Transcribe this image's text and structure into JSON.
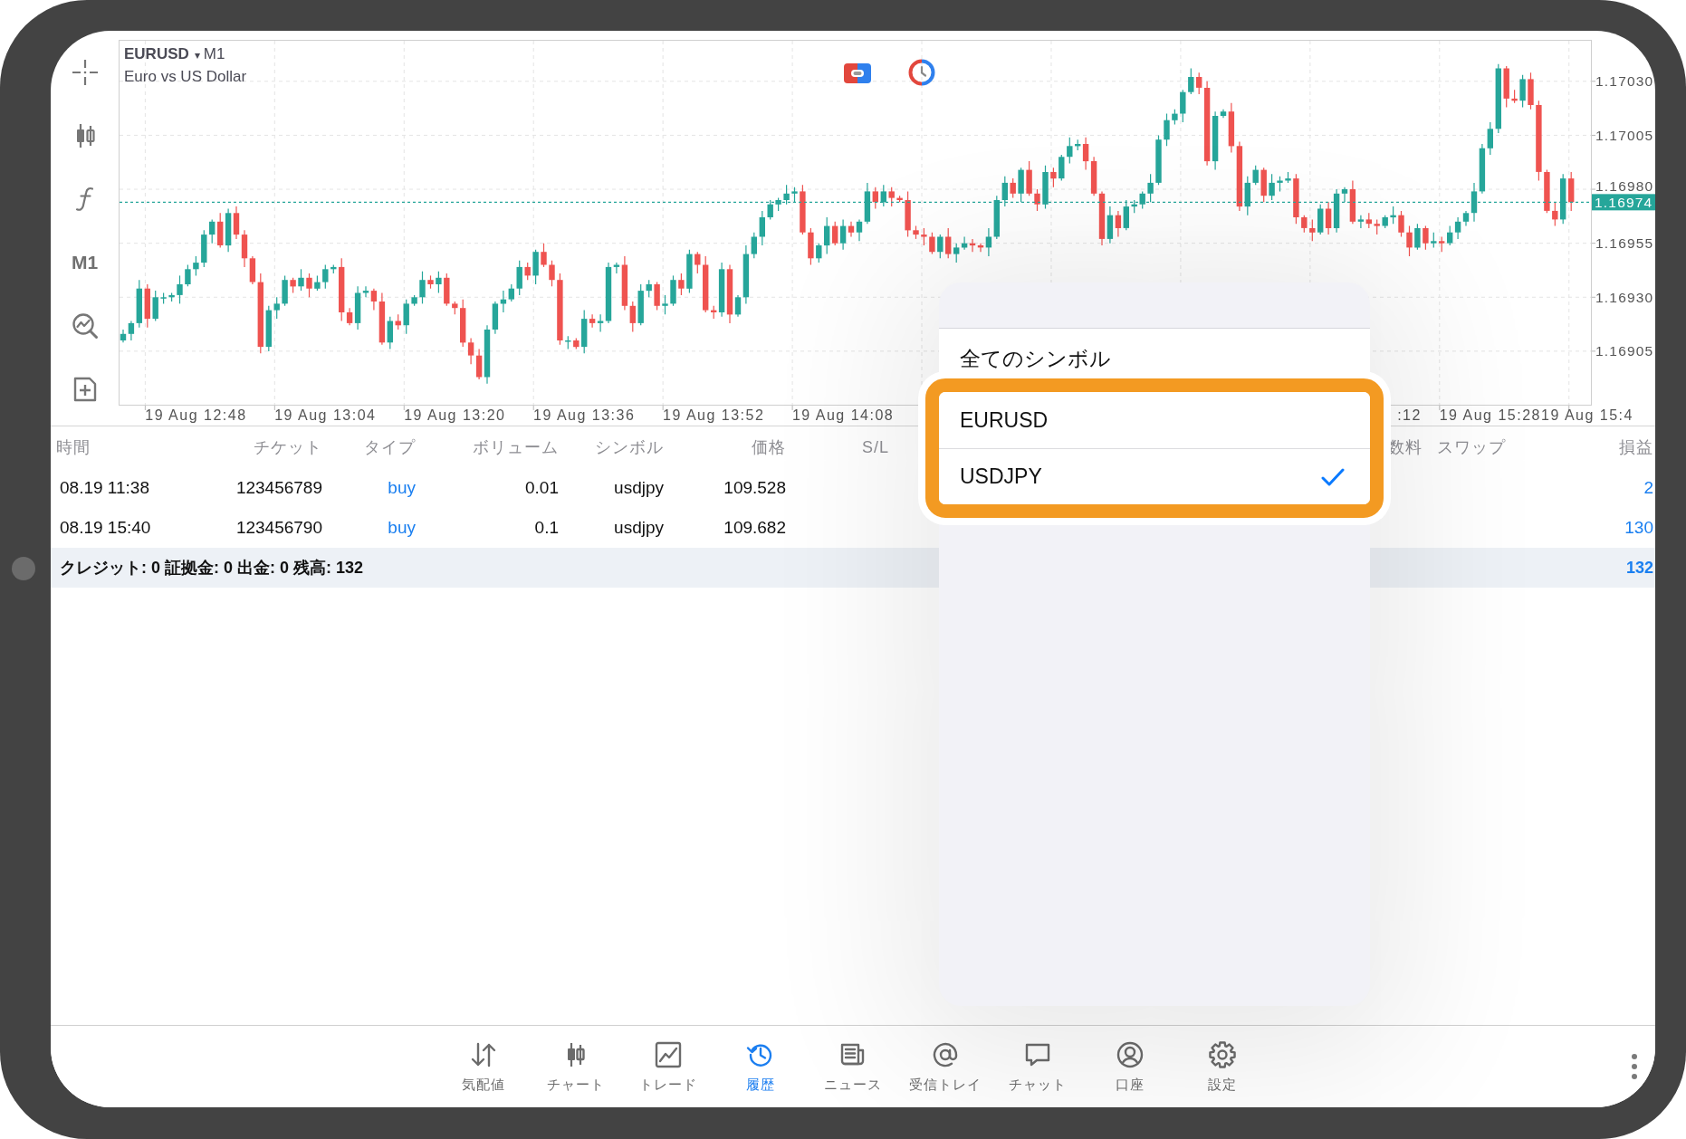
{
  "chart": {
    "symbol": "EURUSD",
    "symbol_caret": "▾",
    "timeframe": "M1",
    "description": "Euro vs US Dollar",
    "toolbar_timeframe": "M1",
    "chart_data": {
      "type": "candlestick",
      "categories": [
        null,
        null,
        null,
        null,
        null,
        null,
        null,
        null,
        null,
        "19 Aug 12:48",
        null,
        null,
        null,
        null,
        null,
        null,
        null,
        null,
        null,
        null,
        null,
        null,
        null,
        null,
        null,
        "19 Aug 13:04",
        null,
        null,
        null,
        null,
        null,
        null,
        null,
        null,
        null,
        null,
        null,
        null,
        null,
        null,
        null,
        "19 Aug 13:20",
        null,
        null,
        null,
        null,
        null,
        null,
        null,
        null,
        null,
        null,
        null,
        null,
        null,
        null,
        null,
        "19 Aug 13:36",
        null,
        null,
        null,
        null,
        null,
        null,
        null,
        null,
        null,
        null,
        null,
        null,
        null,
        null,
        null,
        "19 Aug 13:52",
        null,
        null,
        null,
        null,
        null,
        null,
        null,
        null,
        null,
        null,
        null,
        null,
        null,
        null,
        null,
        "19 Aug 14:08",
        null,
        null,
        null,
        null,
        null,
        null,
        null,
        null,
        null,
        null,
        null,
        null,
        null,
        null,
        null,
        null,
        null,
        null,
        null,
        null,
        null,
        null,
        null,
        null,
        null,
        null,
        null,
        null,
        null,
        null,
        null,
        null,
        null,
        null,
        null,
        null,
        null,
        null,
        null,
        null,
        null,
        null,
        null,
        null,
        null,
        null,
        null,
        null,
        null,
        null,
        null,
        null,
        null,
        null,
        null,
        null,
        null,
        null,
        null,
        null,
        null,
        null,
        null,
        null,
        null,
        null,
        null,
        null,
        null,
        ":12",
        null,
        null,
        null,
        null,
        null,
        null,
        null,
        null,
        null,
        "19 Aug 15:28",
        null,
        null,
        null,
        null,
        null,
        null,
        null,
        null,
        null,
        null,
        null,
        "19 Aug 15:4"
      ],
      "ohlc": [
        [
          1.1691,
          1.16915,
          1.16909,
          1.16913
        ],
        [
          1.16913,
          1.16919,
          1.1691,
          1.16918
        ],
        [
          1.16918,
          1.16938,
          1.16916,
          1.16934
        ],
        [
          1.16934,
          1.16936,
          1.16916,
          1.1692
        ],
        [
          1.1692,
          1.16933,
          1.16919,
          1.1693
        ],
        [
          1.1693,
          1.16932,
          1.16927,
          1.1693
        ],
        [
          1.1693,
          1.16932,
          1.16928,
          1.16931
        ],
        [
          1.16931,
          1.1694,
          1.16927,
          1.16936
        ],
        [
          1.16936,
          1.16945,
          1.16935,
          1.16943
        ],
        [
          1.16943,
          1.16949,
          1.1694,
          1.16946
        ],
        [
          1.16946,
          1.16961,
          1.16944,
          1.16959
        ],
        [
          1.16959,
          1.16966,
          1.16955,
          1.16965
        ],
        [
          1.16965,
          1.16969,
          1.16953,
          1.16954
        ],
        [
          1.16954,
          1.16971,
          1.16951,
          1.16969
        ],
        [
          1.16969,
          1.16972,
          1.16957,
          1.16959
        ],
        [
          1.16959,
          1.16961,
          1.16944,
          1.16948
        ],
        [
          1.16948,
          1.16949,
          1.16936,
          1.16937
        ],
        [
          1.16937,
          1.16941,
          1.16904,
          1.16907
        ],
        [
          1.16907,
          1.16926,
          1.16905,
          1.16924
        ],
        [
          1.16924,
          1.1693,
          1.1692,
          1.16927
        ],
        [
          1.16927,
          1.1694,
          1.16926,
          1.16938
        ],
        [
          1.16938,
          1.16939,
          1.16932,
          1.16935
        ],
        [
          1.16935,
          1.16943,
          1.16933,
          1.16939
        ],
        [
          1.16939,
          1.16941,
          1.1693,
          1.16934
        ],
        [
          1.16934,
          1.1694,
          1.16933,
          1.16937
        ],
        [
          1.16937,
          1.16945,
          1.16934,
          1.16943
        ],
        [
          1.16943,
          1.16945,
          1.16941,
          1.16944
        ],
        [
          1.16944,
          1.16948,
          1.16919,
          1.16923
        ],
        [
          1.16923,
          1.16925,
          1.16917,
          1.16918
        ],
        [
          1.16918,
          1.16935,
          1.16915,
          1.16932
        ],
        [
          1.16932,
          1.16935,
          1.1693,
          1.16933
        ],
        [
          1.16933,
          1.16934,
          1.16924,
          1.16928
        ],
        [
          1.16928,
          1.16932,
          1.16908,
          1.16909
        ],
        [
          1.16909,
          1.16921,
          1.16906,
          1.16919
        ],
        [
          1.16919,
          1.16922,
          1.16915,
          1.16917
        ],
        [
          1.16917,
          1.16929,
          1.16913,
          1.16927
        ],
        [
          1.16927,
          1.16931,
          1.16926,
          1.1693
        ],
        [
          1.1693,
          1.16942,
          1.16927,
          1.16938
        ],
        [
          1.16938,
          1.1694,
          1.16934,
          1.16936
        ],
        [
          1.16936,
          1.16942,
          1.16932,
          1.16939
        ],
        [
          1.16939,
          1.16941,
          1.16926,
          1.16927
        ],
        [
          1.16927,
          1.16928,
          1.16922,
          1.16925
        ],
        [
          1.16925,
          1.16929,
          1.16907,
          1.16909
        ],
        [
          1.16909,
          1.16911,
          1.16899,
          1.16903
        ],
        [
          1.16903,
          1.16906,
          1.16892,
          1.16893
        ],
        [
          1.16893,
          1.16917,
          1.1689,
          1.16915
        ],
        [
          1.16915,
          1.16928,
          1.16913,
          1.16927
        ],
        [
          1.16927,
          1.16933,
          1.16923,
          1.16929
        ],
        [
          1.16929,
          1.16936,
          1.16928,
          1.16934
        ],
        [
          1.16934,
          1.16947,
          1.16931,
          1.16944
        ],
        [
          1.16944,
          1.16946,
          1.16938,
          1.1694
        ],
        [
          1.1694,
          1.16952,
          1.16936,
          1.16951
        ],
        [
          1.16951,
          1.16955,
          1.16944,
          1.16945
        ],
        [
          1.16945,
          1.16947,
          1.16935,
          1.16938
        ],
        [
          1.16938,
          1.16941,
          1.16908,
          1.1691
        ],
        [
          1.1691,
          1.16912,
          1.16906,
          1.1691
        ],
        [
          1.1691,
          1.16911,
          1.16906,
          1.16907
        ],
        [
          1.16907,
          1.16924,
          1.16904,
          1.1692
        ],
        [
          1.1692,
          1.16922,
          1.16916,
          1.16918
        ],
        [
          1.16918,
          1.16922,
          1.16914,
          1.16919
        ],
        [
          1.16919,
          1.16946,
          1.16918,
          1.16944
        ],
        [
          1.16944,
          1.16946,
          1.16941,
          1.16945
        ],
        [
          1.16945,
          1.16949,
          1.16924,
          1.16926
        ],
        [
          1.16926,
          1.16928,
          1.16914,
          1.16918
        ],
        [
          1.16918,
          1.16936,
          1.16917,
          1.16933
        ],
        [
          1.16933,
          1.16938,
          1.1693,
          1.16936
        ],
        [
          1.16936,
          1.16937,
          1.16924,
          1.16926
        ],
        [
          1.16926,
          1.16931,
          1.16922,
          1.16927
        ],
        [
          1.16927,
          1.1694,
          1.16926,
          1.16938
        ],
        [
          1.16938,
          1.16941,
          1.16931,
          1.16934
        ],
        [
          1.16934,
          1.16952,
          1.16932,
          1.1695
        ],
        [
          1.1695,
          1.16951,
          1.16941,
          1.16945
        ],
        [
          1.16945,
          1.16949,
          1.16923,
          1.16924
        ],
        [
          1.16924,
          1.16926,
          1.1692,
          1.16923
        ],
        [
          1.16923,
          1.16946,
          1.16921,
          1.16943
        ],
        [
          1.16943,
          1.16945,
          1.16918,
          1.16922
        ],
        [
          1.16922,
          1.16931,
          1.16921,
          1.1693
        ],
        [
          1.1693,
          1.16954,
          1.16927,
          1.1695
        ],
        [
          1.1695,
          1.1696,
          1.16948,
          1.16958
        ],
        [
          1.16958,
          1.1697,
          1.16954,
          1.16967
        ],
        [
          1.16967,
          1.16975,
          1.16966,
          1.16973
        ],
        [
          1.16973,
          1.16976,
          1.1697,
          1.16975
        ],
        [
          1.16975,
          1.16982,
          1.16973,
          1.16978
        ],
        [
          1.16978,
          1.16981,
          1.16974,
          1.16979
        ],
        [
          1.16979,
          1.16982,
          1.16959,
          1.1696
        ],
        [
          1.1696,
          1.16962,
          1.16945,
          1.16948
        ],
        [
          1.16948,
          1.16955,
          1.16946,
          1.16954
        ],
        [
          1.16954,
          1.16967,
          1.1695,
          1.16963
        ],
        [
          1.16963,
          1.16965,
          1.16954,
          1.16955
        ],
        [
          1.16955,
          1.16966,
          1.16952,
          1.16963
        ],
        [
          1.16963,
          1.16965,
          1.16958,
          1.1696
        ],
        [
          1.1696,
          1.16966,
          1.16956,
          1.16965
        ],
        [
          1.16965,
          1.16983,
          1.16964,
          1.16979
        ],
        [
          1.16979,
          1.16981,
          1.16971,
          1.16974
        ],
        [
          1.16974,
          1.16982,
          1.16972,
          1.16979
        ],
        [
          1.16979,
          1.16981,
          1.16972,
          1.16976
        ],
        [
          1.16976,
          1.16977,
          1.16974,
          1.16975
        ],
        [
          1.16975,
          1.16979,
          1.16958,
          1.16961
        ],
        [
          1.16961,
          1.16963,
          1.16957,
          1.16959
        ],
        [
          1.16959,
          1.16962,
          1.16954,
          1.16958
        ],
        [
          1.16958,
          1.1696,
          1.1695,
          1.16951
        ],
        [
          1.16951,
          1.16959,
          1.16948,
          1.16958
        ],
        [
          1.16958,
          1.16962,
          1.16948,
          1.1695
        ],
        [
          1.1695,
          1.16955,
          1.16946,
          1.16953
        ],
        [
          1.16953,
          1.16958,
          1.16952,
          1.16955
        ],
        [
          1.16955,
          1.16957,
          1.16951,
          1.16954
        ],
        [
          1.16954,
          1.16955,
          1.16951,
          1.16953
        ],
        [
          1.16953,
          1.16962,
          1.16949,
          1.16958
        ],
        [
          1.16958,
          1.16977,
          1.16957,
          1.16975
        ],
        [
          1.16975,
          1.16986,
          1.16972,
          1.16983
        ],
        [
          1.16983,
          1.16985,
          1.16976,
          1.16978
        ],
        [
          1.16978,
          1.1699,
          1.16974,
          1.16989
        ],
        [
          1.16989,
          1.16993,
          1.16977,
          1.16978
        ],
        [
          1.16978,
          1.1698,
          1.1697,
          1.16973
        ],
        [
          1.16973,
          1.16991,
          1.16971,
          1.16988
        ],
        [
          1.16988,
          1.1699,
          1.16981,
          1.16985
        ],
        [
          1.16985,
          1.16996,
          1.16984,
          1.16995
        ],
        [
          1.16995,
          1.17004,
          1.16992,
          1.17
        ],
        [
          1.17,
          1.17003,
          1.16998,
          1.17001
        ],
        [
          1.17001,
          1.17004,
          1.16989,
          1.16993
        ],
        [
          1.16993,
          1.16995,
          1.16977,
          1.16978
        ],
        [
          1.16978,
          1.16979,
          1.16954,
          1.16957
        ],
        [
          1.16957,
          1.16972,
          1.16955,
          1.16968
        ],
        [
          1.16968,
          1.1697,
          1.16958,
          1.16962
        ],
        [
          1.16962,
          1.16975,
          1.16961,
          1.16972
        ],
        [
          1.16972,
          1.16975,
          1.16969,
          1.16973
        ],
        [
          1.16973,
          1.16979,
          1.16971,
          1.16978
        ],
        [
          1.16978,
          1.16987,
          1.16974,
          1.16983
        ],
        [
          1.16983,
          1.17005,
          1.16982,
          1.17003
        ],
        [
          1.17003,
          1.17015,
          1.17,
          1.17012
        ],
        [
          1.17012,
          1.17017,
          1.1701,
          1.17015
        ],
        [
          1.17015,
          1.17026,
          1.17011,
          1.17025
        ],
        [
          1.17025,
          1.17036,
          1.17024,
          1.17032
        ],
        [
          1.17032,
          1.17034,
          1.17024,
          1.17027
        ],
        [
          1.17027,
          1.1703,
          1.16991,
          1.16993
        ],
        [
          1.16993,
          1.17016,
          1.16989,
          1.17014
        ],
        [
          1.17014,
          1.17017,
          1.17013,
          1.17016
        ],
        [
          1.17016,
          1.1702,
          1.16997,
          1.17
        ],
        [
          1.17,
          1.17002,
          1.1697,
          1.16972
        ],
        [
          1.16972,
          1.16986,
          1.16968,
          1.16983
        ],
        [
          1.16983,
          1.16991,
          1.16982,
          1.16989
        ],
        [
          1.16989,
          1.1699,
          1.16974,
          1.16977
        ],
        [
          1.16977,
          1.16987,
          1.16975,
          1.16983
        ],
        [
          1.16983,
          1.16986,
          1.16979,
          1.16984
        ],
        [
          1.16984,
          1.16988,
          1.16983,
          1.16985
        ],
        [
          1.16985,
          1.16987,
          1.16964,
          1.16967
        ],
        [
          1.16967,
          1.16968,
          1.1696,
          1.16962
        ],
        [
          1.16962,
          1.16966,
          1.16956,
          1.1696
        ],
        [
          1.1696,
          1.16973,
          1.16959,
          1.16971
        ],
        [
          1.16971,
          1.16974,
          1.16959,
          1.16962
        ],
        [
          1.16962,
          1.1698,
          1.1696,
          1.16978
        ],
        [
          1.16978,
          1.16981,
          1.16974,
          1.1698
        ],
        [
          1.1698,
          1.16984,
          1.16964,
          1.16965
        ],
        [
          1.16965,
          1.16968,
          1.16962,
          1.16966
        ],
        [
          1.16966,
          1.16969,
          1.16962,
          1.16964
        ],
        [
          1.16964,
          1.16966,
          1.16959,
          1.16963
        ],
        [
          1.16963,
          1.16968,
          1.16962,
          1.16967
        ],
        [
          1.16967,
          1.16972,
          1.16964,
          1.16968
        ],
        [
          1.16968,
          1.1697,
          1.16958,
          1.1696
        ],
        [
          1.1696,
          1.16963,
          1.16949,
          1.16953
        ],
        [
          1.16953,
          1.16964,
          1.16952,
          1.16962
        ],
        [
          1.16962,
          1.16963,
          1.16952,
          1.16955
        ],
        [
          1.16955,
          1.1696,
          1.16953,
          1.16956
        ],
        [
          1.16956,
          1.16958,
          1.16951,
          1.16955
        ],
        [
          1.16955,
          1.16963,
          1.16954,
          1.1696
        ],
        [
          1.1696,
          1.16967,
          1.16957,
          1.16965
        ],
        [
          1.16965,
          1.1697,
          1.16963,
          1.16969
        ],
        [
          1.16969,
          1.16983,
          1.16965,
          1.16979
        ],
        [
          1.16979,
          1.17001,
          1.16978,
          1.16999
        ],
        [
          1.16999,
          1.17011,
          1.16996,
          1.17008
        ],
        [
          1.17008,
          1.17038,
          1.17006,
          1.17036
        ],
        [
          1.17036,
          1.17037,
          1.17018,
          1.17022
        ],
        [
          1.17022,
          1.17026,
          1.1702,
          1.17021
        ],
        [
          1.17021,
          1.17033,
          1.17018,
          1.17031
        ],
        [
          1.17031,
          1.17034,
          1.17017,
          1.17019
        ],
        [
          1.17019,
          1.17021,
          1.16984,
          1.16988
        ],
        [
          1.16988,
          1.16989,
          1.16969,
          1.1697
        ],
        [
          1.1697,
          1.16974,
          1.16963,
          1.16966
        ],
        [
          1.16966,
          1.16987,
          1.16964,
          1.16985
        ],
        [
          1.16985,
          1.16988,
          1.1697,
          1.16974
        ],
        null,
        null
      ],
      "ylim": [
        1.1688,
        1.17049
      ],
      "grid": true,
      "yticks": [
        {
          "value": 1.1703,
          "label": "1.17030"
        },
        {
          "value": 1.17005,
          "label": "1.17005"
        },
        {
          "value": 1.1698,
          "label": "1.16980"
        },
        {
          "value": 1.16955,
          "label": "1.16955"
        },
        {
          "value": 1.1693,
          "label": "1.16930"
        },
        {
          "value": 1.16905,
          "label": "1.16905"
        }
      ],
      "ref_lines": [
        {
          "axis": "y",
          "value": 1.16974,
          "label": "1.16974"
        }
      ]
    }
  },
  "history": {
    "columns": [
      "時間",
      "チケット",
      "タイプ",
      "ボリューム",
      "シンボル",
      "価格",
      "S/L",
      "数料",
      "スワップ",
      "損益"
    ],
    "rows": [
      {
        "time": "08.19 11:38",
        "ticket": "123456789",
        "type": "buy",
        "volume": "0.01",
        "symbol": "usdjpy",
        "price": "109.528",
        "profit": "2"
      },
      {
        "time": "08.19 15:40",
        "ticket": "123456790",
        "type": "buy",
        "volume": "0.1",
        "symbol": "usdjpy",
        "price": "109.682",
        "profit": "130"
      }
    ],
    "summary": "クレジット: 0 証拠金: 0 出金: 0 残高: 132",
    "summary_profit": "132"
  },
  "symbol_menu": {
    "items": [
      {
        "label": "全てのシンボル",
        "selected": false,
        "highlighted": false
      },
      {
        "label": "EURUSD",
        "selected": false,
        "highlighted": true
      },
      {
        "label": "USDJPY",
        "selected": true,
        "highlighted": true
      }
    ]
  },
  "tab_bar": {
    "tabs": [
      {
        "label": "気配値",
        "selected": false
      },
      {
        "label": "チャート",
        "selected": false
      },
      {
        "label": "トレード",
        "selected": false
      },
      {
        "label": "履歴",
        "selected": true
      },
      {
        "label": "ニュース",
        "selected": false
      },
      {
        "label": "受信トレイ",
        "selected": false
      },
      {
        "label": "チャット",
        "selected": false
      },
      {
        "label": "口座",
        "selected": false
      },
      {
        "label": "設定",
        "selected": false
      }
    ]
  }
}
